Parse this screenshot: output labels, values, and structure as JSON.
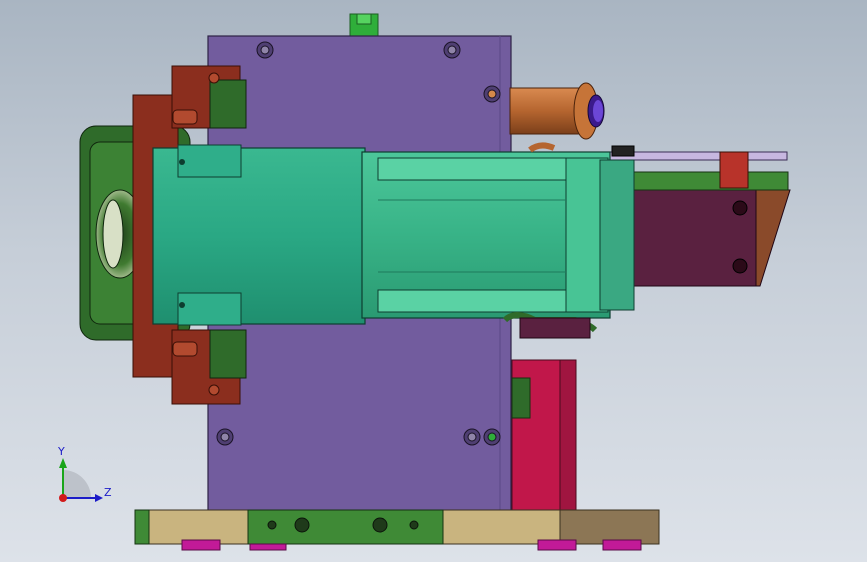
{
  "view": {
    "triad": {
      "x_label": "",
      "y_label": "Y",
      "z_label": "Z"
    }
  },
  "colors": {
    "background_top": "#a9b5c2",
    "background_bottom": "#dde2e9",
    "main_plate": "#725c9e",
    "motor_body": "#2aae8a",
    "motor_gearbox": "#3bbd8c",
    "bracket_brown": "#8b2e1e",
    "bracket_dark_green": "#2f6b2a",
    "base_tan": "#c9b47f",
    "base_green": "#3f8a36",
    "roller_copper": "#b5652f",
    "support_magenta": "#c1174a",
    "cam_plate_dark": "#5a2140",
    "feet_magenta": "#c21a98",
    "knob_green": "#2fae3a"
  }
}
